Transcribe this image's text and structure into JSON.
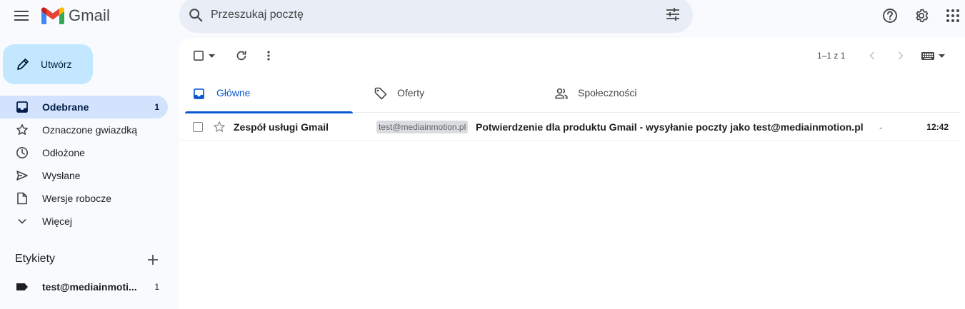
{
  "app": {
    "name": "Gmail"
  },
  "search": {
    "placeholder": "Przeszukaj pocztę"
  },
  "compose": {
    "label": "Utwórz"
  },
  "nav": {
    "items": [
      {
        "label": "Odebrane",
        "count": "1"
      },
      {
        "label": "Oznaczone gwiazdką",
        "count": ""
      },
      {
        "label": "Odłożone",
        "count": ""
      },
      {
        "label": "Wysłane",
        "count": ""
      },
      {
        "label": "Wersje robocze",
        "count": ""
      },
      {
        "label": "Więcej",
        "count": ""
      }
    ]
  },
  "labels": {
    "title": "Etykiety",
    "items": [
      {
        "label": "test@mediainmoti...",
        "count": "1"
      }
    ]
  },
  "toolbar": {
    "pager": "1–1 z 1"
  },
  "tabs": [
    {
      "label": "Główne"
    },
    {
      "label": "Oferty"
    },
    {
      "label": "Społeczności"
    }
  ],
  "messages": [
    {
      "sender": "Zespół usługi Gmail",
      "badge": "test@mediainmotion.pl",
      "subject": "Potwierdzenie dla produktu Gmail - wysyłanie poczty jako test@mediainmotion.pl",
      "snippet": "-",
      "time": "12:42"
    }
  ],
  "colors": {
    "accent": "#0b57d0",
    "compose_bg": "#c2e7ff",
    "active_nav_bg": "#d3e3fd",
    "search_bg": "#e9eef6"
  }
}
